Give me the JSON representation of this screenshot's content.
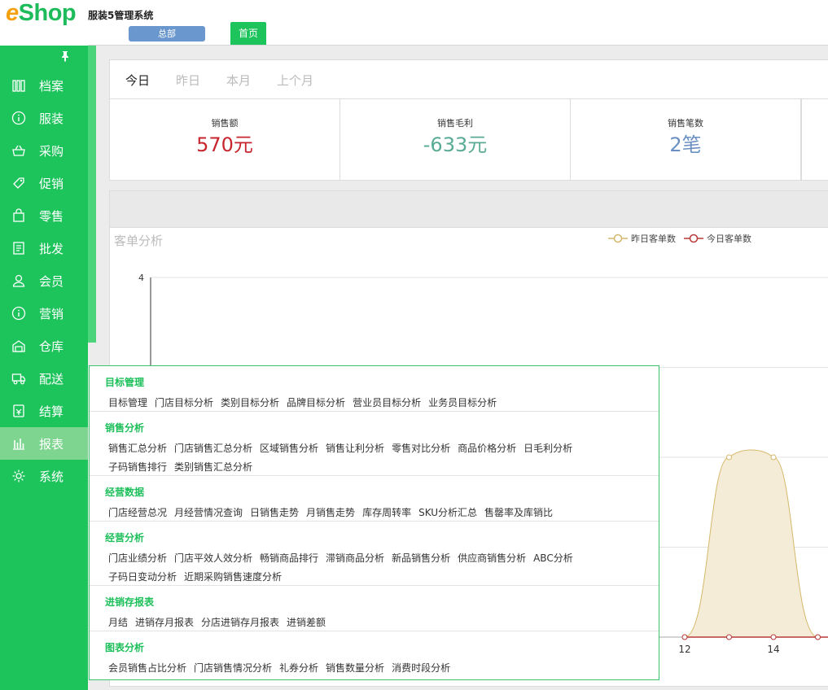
{
  "header": {
    "logo_e": "e",
    "logo_shop": "Shop",
    "system_title": "服装5管理系统",
    "branch_button": "总部",
    "home_tab": "首页"
  },
  "sidebar": {
    "pin_icon": "pushpin-icon",
    "items": [
      {
        "label": "档案",
        "icon": "books-icon"
      },
      {
        "label": "服装",
        "icon": "info-circle-icon"
      },
      {
        "label": "采购",
        "icon": "basket-icon"
      },
      {
        "label": "促销",
        "icon": "tag-icon"
      },
      {
        "label": "零售",
        "icon": "shopping-bag-icon"
      },
      {
        "label": "批发",
        "icon": "receipt-icon"
      },
      {
        "label": "会员",
        "icon": "user-icon"
      },
      {
        "label": "营销",
        "icon": "info-circle-icon"
      },
      {
        "label": "仓库",
        "icon": "warehouse-icon"
      },
      {
        "label": "配送",
        "icon": "truck-icon"
      },
      {
        "label": "结算",
        "icon": "wallet-icon"
      },
      {
        "label": "报表",
        "icon": "bar-chart-icon",
        "active": true
      },
      {
        "label": "系统",
        "icon": "gear-icon"
      }
    ]
  },
  "date_tabs": [
    "今日",
    "昨日",
    "本月",
    "上个月"
  ],
  "active_date_tab": 0,
  "stats": [
    {
      "label": "销售额",
      "value": "570元",
      "color": "#c8262f"
    },
    {
      "label": "销售毛利",
      "value": "-633元",
      "color": "#5aab95"
    },
    {
      "label": "销售笔数",
      "value": "2笔",
      "color": "#6a8fc0"
    }
  ],
  "chart_data": {
    "type": "line",
    "title": "客单分析",
    "y_tick_top": "4",
    "x_ticks": [
      "12",
      "14"
    ],
    "x": [
      12,
      13,
      14,
      15
    ],
    "ylim": [
      0,
      4
    ],
    "series": [
      {
        "name": "昨日客单数",
        "color": "#d4b86a",
        "values": [
          0,
          2,
          2,
          0
        ]
      },
      {
        "name": "今日客单数",
        "color": "#b83a3a",
        "values": [
          0,
          0,
          0,
          0
        ]
      }
    ],
    "legend_position": "top-right"
  },
  "report_menu": [
    {
      "title": "目标管理",
      "rows": [
        [
          "目标管理",
          "门店目标分析",
          "类别目标分析",
          "品牌目标分析",
          "营业员目标分析",
          "业务员目标分析"
        ]
      ]
    },
    {
      "title": "销售分析",
      "rows": [
        [
          "销售汇总分析",
          "门店销售汇总分析",
          "区域销售分析",
          "销售让利分析",
          "零售对比分析",
          "商品价格分析",
          "日毛利分析"
        ],
        [
          "子码销售排行",
          "类别销售汇总分析"
        ]
      ]
    },
    {
      "title": "经营数据",
      "rows": [
        [
          "门店经营总况",
          "月经营情况查询",
          "日销售走势",
          "月销售走势",
          "库存周转率",
          "SKU分析汇总",
          "售罄率及库销比"
        ]
      ]
    },
    {
      "title": "经营分析",
      "rows": [
        [
          "门店业绩分析",
          "门店平效人效分析",
          "畅销商品排行",
          "滞销商品分析",
          "新品销售分析",
          "供应商销售分析",
          "ABC分析"
        ],
        [
          "子码日变动分析",
          "近期采购销售速度分析"
        ]
      ]
    },
    {
      "title": "进销存报表",
      "rows": [
        [
          "月结",
          "进销存月报表",
          "分店进销存月报表",
          "进销差额"
        ]
      ]
    },
    {
      "title": "图表分析",
      "rows": [
        [
          "会员销售占比分析",
          "门店销售情况分析",
          "礼券分析",
          "销售数量分析",
          "消费时段分析"
        ]
      ]
    }
  ]
}
